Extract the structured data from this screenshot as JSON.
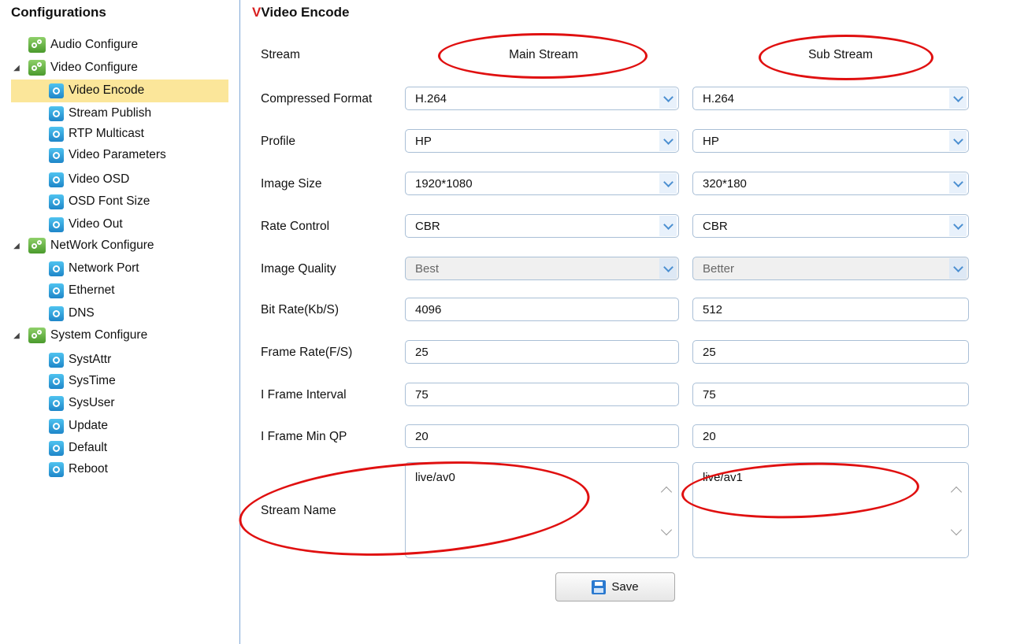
{
  "sidebar": {
    "title": "Configurations",
    "items": [
      {
        "label": "Audio Configure"
      },
      {
        "label": "Video Configure"
      },
      {
        "label": "Video Encode"
      },
      {
        "label": "Stream Publish"
      },
      {
        "label": "RTP Multicast"
      },
      {
        "label": "Video Parameters"
      },
      {
        "label": "Video OSD"
      },
      {
        "label": "OSD Font Size"
      },
      {
        "label": "Video Out"
      },
      {
        "label": "NetWork Configure"
      },
      {
        "label": "Network Port"
      },
      {
        "label": "Ethernet"
      },
      {
        "label": "DNS"
      },
      {
        "label": "System Configure"
      },
      {
        "label": "SystAttr"
      },
      {
        "label": "SysTime"
      },
      {
        "label": "SysUser"
      },
      {
        "label": "Update"
      },
      {
        "label": "Default"
      },
      {
        "label": "Reboot"
      }
    ],
    "selected": "Video Encode"
  },
  "main": {
    "title": "Video Encode",
    "stream_label": "Stream",
    "main_stream_label": "Main Stream",
    "sub_stream_label": "Sub Stream",
    "rows": {
      "compressed_format": {
        "label": "Compressed Format",
        "main": "H.264",
        "sub": "H.264"
      },
      "profile": {
        "label": "Profile",
        "main": "HP",
        "sub": "HP"
      },
      "image_size": {
        "label": "Image Size",
        "main": "1920*1080",
        "sub": "320*180"
      },
      "rate_control": {
        "label": "Rate Control",
        "main": "CBR",
        "sub": "CBR"
      },
      "image_quality": {
        "label": "Image Quality",
        "main": "Best",
        "sub": "Better"
      },
      "bit_rate": {
        "label": "Bit Rate(Kb/S)",
        "main": "4096",
        "sub": "512"
      },
      "frame_rate": {
        "label": "Frame Rate(F/S)",
        "main": "25",
        "sub": "25"
      },
      "i_frame_interval": {
        "label": "I Frame Interval",
        "main": "75",
        "sub": "75"
      },
      "i_frame_min_qp": {
        "label": "I Frame Min QP",
        "main": "20",
        "sub": "20"
      },
      "stream_name": {
        "label": "Stream Name",
        "main": "live/av0",
        "sub": "live/av1"
      }
    },
    "save_label": "Save"
  },
  "colors": {
    "selected_bg": "#fbe69a",
    "annotation": "#e01010",
    "accent": "#4b8fd1"
  }
}
